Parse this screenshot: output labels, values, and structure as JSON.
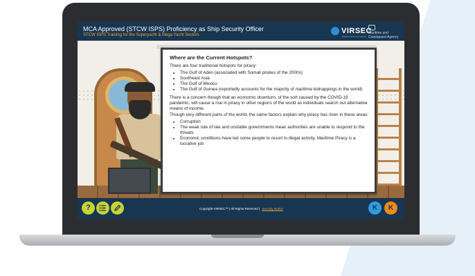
{
  "course": {
    "title": "MCA Approved (STCW ISPS) Proficiency as Ship Security Officer",
    "subtitle": "STCW ISPS Training for the Superyacht & Mega Yacht Sectors"
  },
  "branding": {
    "logo_text": "VIRSEC",
    "logo_tagline": "Maritime Security Training",
    "agency_text": "Maritime and Coastguard Agency"
  },
  "slide": {
    "heading": "Where are the Current Hotspots?",
    "intro": "There are four traditional hotspots for piracy:",
    "hotspots": [
      "The Gulf of Aden (associated with Somali pirates of the 2000s)",
      "Southeast Asia",
      "The Gulf of Mexico",
      "The Gulf of Guinea (reportedly accounts for the majority of maritime kidnappings in the world)"
    ],
    "para1": "There is a concern though that an economic downturn, of the sort caused by the COVID-19 pandemic, will cause a rise in piracy in other regions of the world as individuals search out alternative means of income.",
    "para2": "Though very different parts of the world, the same factors explain why piracy has risen in these areas:",
    "factors": [
      "Corruption",
      "The weak rule of law and unstable governments mean authorities are unable to respond to the threats",
      "Economic conditions have led some people to resort to illegal activity, Maritime Piracy is a lucrative job"
    ]
  },
  "footer": {
    "help_icon": "?",
    "menu_icon": "list-icon",
    "notes_icon": "pencil-icon",
    "copyright": "Copyright VIRSEC™ | All Rights Reserved |",
    "link": "Security Notice",
    "prev_icon": "K",
    "next_icon": "K"
  },
  "colors": {
    "header_bg": "#183651",
    "subtitle": "#f4a736",
    "footer_button": "#c7d336",
    "prev_button": "#2e9ddc",
    "next_button": "#f08a1a"
  }
}
